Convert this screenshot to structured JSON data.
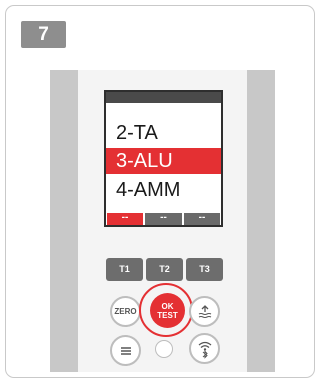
{
  "step": {
    "number": "7"
  },
  "screen": {
    "menu_items": [
      {
        "label": "2-TA",
        "selected": false
      },
      {
        "label": "3-ALU",
        "selected": true
      },
      {
        "label": "4-AMM",
        "selected": false
      }
    ],
    "softkeys": [
      "--",
      "--",
      "--"
    ]
  },
  "keys": {
    "t1": "T1",
    "t2": "T2",
    "t3": "T3",
    "zero": "ZERO",
    "ok_line1": "OK",
    "ok_line2": "TEST"
  },
  "icons": {
    "menu": "menu-icon",
    "wifi": "wifi-icon",
    "bluetooth": "bluetooth-icon",
    "level": "level-icon"
  },
  "colors": {
    "accent": "#e43033",
    "badge": "#8e8e8e"
  }
}
